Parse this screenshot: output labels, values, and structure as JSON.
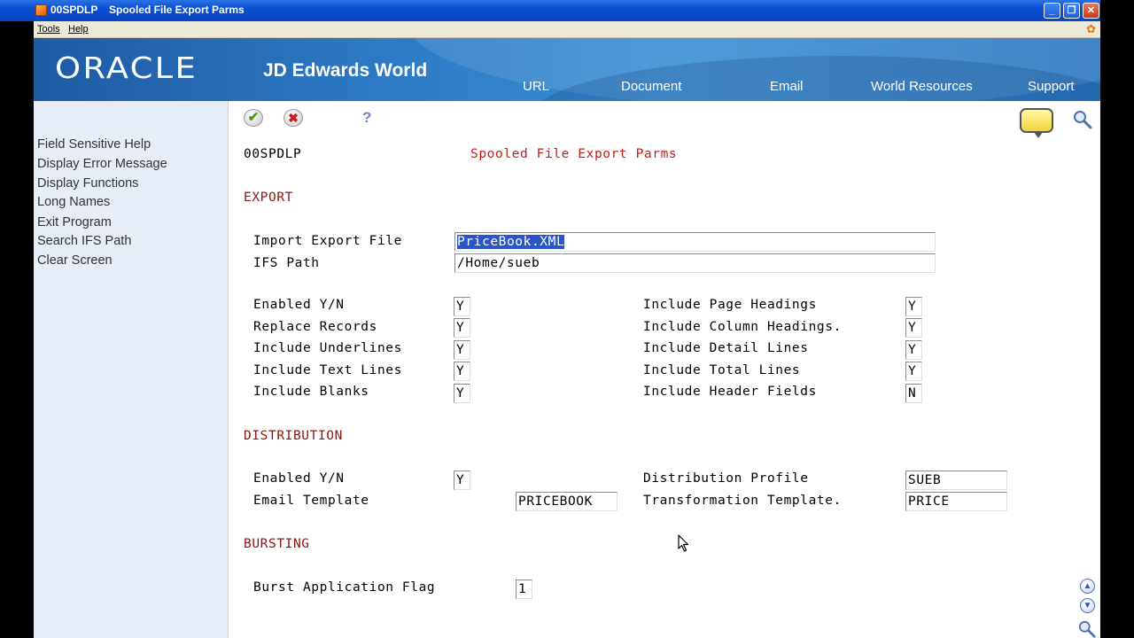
{
  "window": {
    "program_code": "00SPDLP",
    "title": "Spooled File Export Parms",
    "controls": [
      "_",
      "❐",
      "✕"
    ]
  },
  "menubar": {
    "tools": "Tools",
    "help": "Help"
  },
  "banner": {
    "brand": "ORACLE",
    "product": "JD Edwards World",
    "nav": [
      "URL",
      "Document",
      "Email",
      "World Resources",
      "Support"
    ]
  },
  "sidebar": {
    "items": [
      "Field Sensitive Help",
      "Display Error Message",
      "Display Functions",
      "Long Names",
      "Exit Program",
      "Search IFS Path",
      "Clear Screen"
    ]
  },
  "toolbar": {
    "ok_icon": "✔",
    "cancel_icon": "✖",
    "help_icon": "?"
  },
  "form": {
    "program_id": "00SPDLP",
    "form_title": "Spooled File Export Parms",
    "export_section": "EXPORT",
    "import_export_file_label": "Import Export File",
    "import_export_file_value": "PriceBook.XML",
    "ifs_path_label": "IFS Path",
    "ifs_path_value": "/Home/sueb",
    "left_flags": [
      {
        "label": "Enabled Y/N",
        "value": "Y"
      },
      {
        "label": "Replace Records",
        "value": "Y"
      },
      {
        "label": "Include Underlines",
        "value": "Y"
      },
      {
        "label": "Include Text Lines",
        "value": "Y"
      },
      {
        "label": "Include Blanks",
        "value": "Y"
      }
    ],
    "right_flags": [
      {
        "label": "Include Page Headings",
        "value": "Y"
      },
      {
        "label": "Include Column Headings.",
        "value": "Y"
      },
      {
        "label": "Include Detail Lines",
        "value": "Y"
      },
      {
        "label": "Include Total Lines",
        "value": "Y"
      },
      {
        "label": "Include Header Fields",
        "value": "N"
      }
    ],
    "distribution_section": "DISTRIBUTION",
    "dist_enabled_label": "Enabled Y/N",
    "dist_enabled_value": "Y",
    "email_template_label": "Email Template",
    "email_template_value": "PRICEBOOK",
    "distribution_profile_label": "Distribution Profile",
    "distribution_profile_value": "SUEB",
    "transformation_template_label": "Transformation Template.",
    "transformation_template_value": "PRICE",
    "bursting_section": "BURSTING",
    "burst_flag_label": "Burst Application Flag",
    "burst_flag_value": "1"
  },
  "colors": {
    "title_bar": "#0a4fd0",
    "banner": "#2f7cc6",
    "sidebar_bg": "#e7edf6",
    "form_title": "#c0201a",
    "section_heading": "#8a1612",
    "selection": "#2a55c8"
  }
}
